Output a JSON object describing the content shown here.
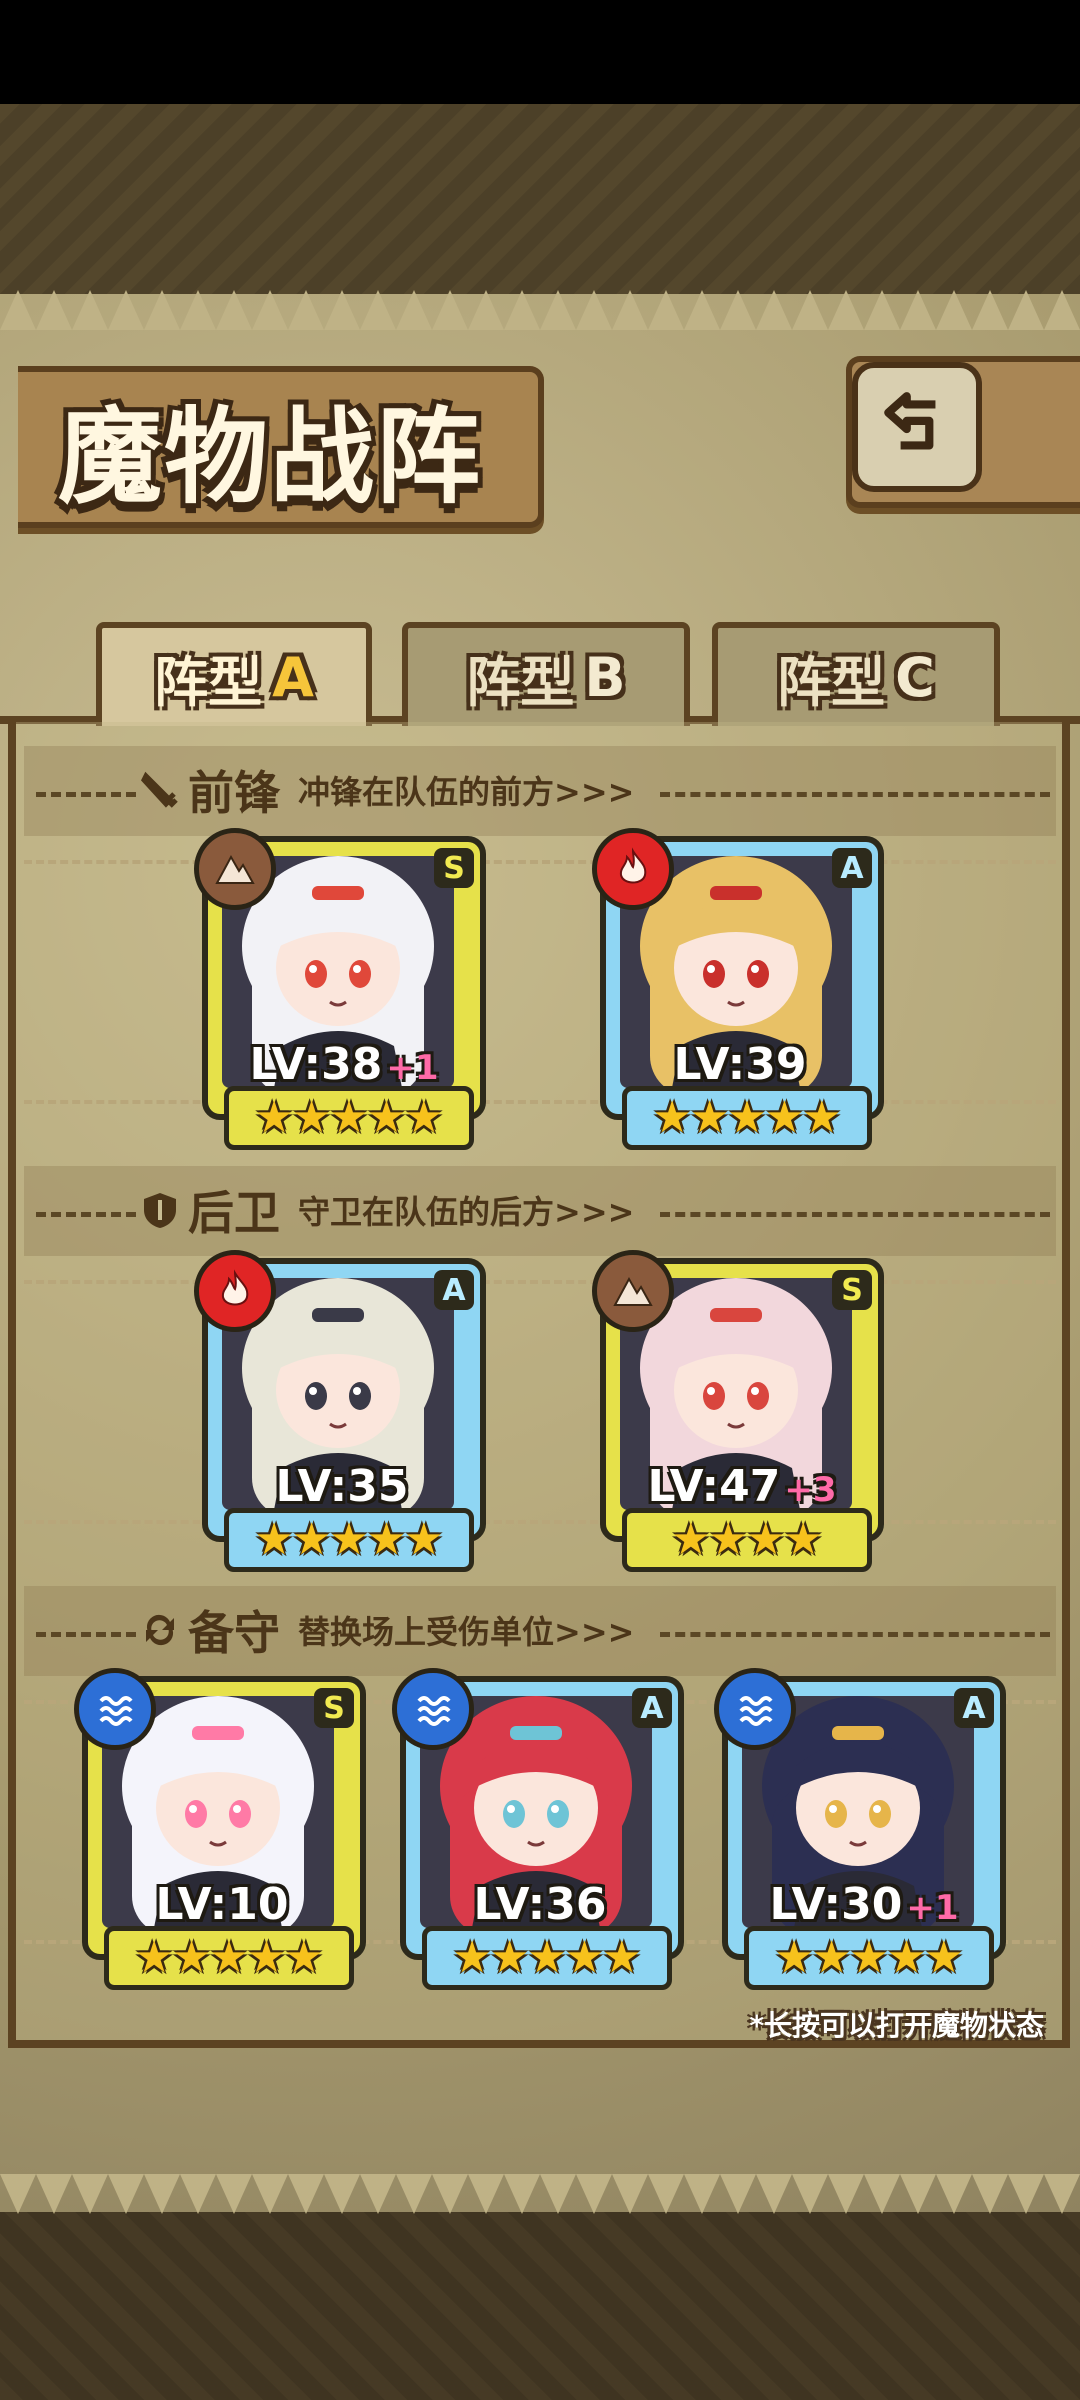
{
  "title": "魔物战阵",
  "tabs": [
    {
      "label": "阵型",
      "letter": "A",
      "active": true
    },
    {
      "label": "阵型",
      "letter": "B",
      "active": false
    },
    {
      "label": "阵型",
      "letter": "C",
      "active": false
    }
  ],
  "sections": {
    "front": {
      "title": "前锋",
      "desc": "冲锋在队伍的前方>>>",
      "icon": "sword-icon"
    },
    "rear": {
      "title": "后卫",
      "desc": "守卫在队伍的后方>>>",
      "icon": "shield-icon"
    },
    "reserve": {
      "title": "备守",
      "desc": "替换场上受伤单位>>>",
      "icon": "swap-icon"
    }
  },
  "front_units": [
    {
      "rank": "S",
      "element": "earth",
      "level": "LV:38",
      "bonus": "+1",
      "stars": 5,
      "hair": "#f2f2f6",
      "accent": "#e0483a"
    },
    {
      "rank": "A",
      "element": "fire",
      "level": "LV:39",
      "bonus": "",
      "stars": 5,
      "hair": "#e8c166",
      "accent": "#c9302c"
    }
  ],
  "rear_units": [
    {
      "rank": "A",
      "element": "fire",
      "level": "LV:35",
      "bonus": "",
      "stars": 5,
      "hair": "#e8e6d8",
      "accent": "#3a3a48"
    },
    {
      "rank": "S",
      "element": "earth",
      "level": "LV:47",
      "bonus": "+3",
      "stars": 4,
      "hair": "#f2d7dc",
      "accent": "#d9463e"
    }
  ],
  "reserve_units": [
    {
      "rank": "S",
      "element": "water",
      "level": "LV:10",
      "bonus": "",
      "stars": 5,
      "hair": "#f4f4fb",
      "accent": "#ff7aa6"
    },
    {
      "rank": "A",
      "element": "water",
      "level": "LV:36",
      "bonus": "",
      "stars": 5,
      "hair": "#d93a4a",
      "accent": "#6ec4d6"
    },
    {
      "rank": "A",
      "element": "water",
      "level": "LV:30",
      "bonus": "+1",
      "stars": 5,
      "hair": "#2c2f52",
      "accent": "#e6b54a"
    }
  ],
  "footnote": "*长按可以打开魔物状态",
  "colors": {
    "rank_s": "#e6e14a",
    "rank_a": "#8fd6f3",
    "star": "#f7c21c",
    "fire": "#e02525",
    "earth": "#8a5a3c",
    "water": "#2d6fd6"
  }
}
